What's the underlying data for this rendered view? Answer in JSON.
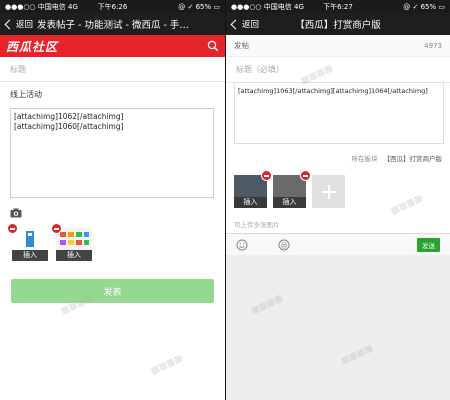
{
  "left": {
    "status": {
      "carrier": "●●●○○ 中国电信  4G",
      "time": "下午6:26",
      "battery": "@ ✓ 65% ▭"
    },
    "nav": {
      "back": "返回",
      "title": "发表帖子 - 功能测试 - 微西瓜 - 手…"
    },
    "logo": "西瓜社区",
    "form": {
      "title_placeholder": "标题",
      "category": "线上活动",
      "content": "[attachimg]1062[/attachimg]\n[attachimg]1060[/attachimg]",
      "attachments": [
        {
          "label": "插入"
        },
        {
          "label": "插入"
        }
      ],
      "submit": "发表"
    }
  },
  "right": {
    "status": {
      "carrier": "●●●○○ 中国电信  4G",
      "time": "下午6:27",
      "battery": "@ ✓ 65% ▭"
    },
    "nav": {
      "back": "返回",
      "title": "【西瓜】打赏商户版"
    },
    "header": {
      "label": "发帖",
      "count": "4973"
    },
    "form": {
      "title_placeholder": "标题（必填）",
      "content": "[attachimg]1063[/attachimg][attachimg]1064[/attachimg]",
      "board_label": "所在板块",
      "board_value": "【西瓜】打赏商户版",
      "attachments": [
        {
          "label": "插入"
        },
        {
          "label": "插入"
        }
      ],
      "hint": "可上传多张图片",
      "send": "发送"
    }
  },
  "colors": {
    "brand_red": "#e8242b",
    "submit_green": "#95d990",
    "send_green": "#2aa42e"
  }
}
